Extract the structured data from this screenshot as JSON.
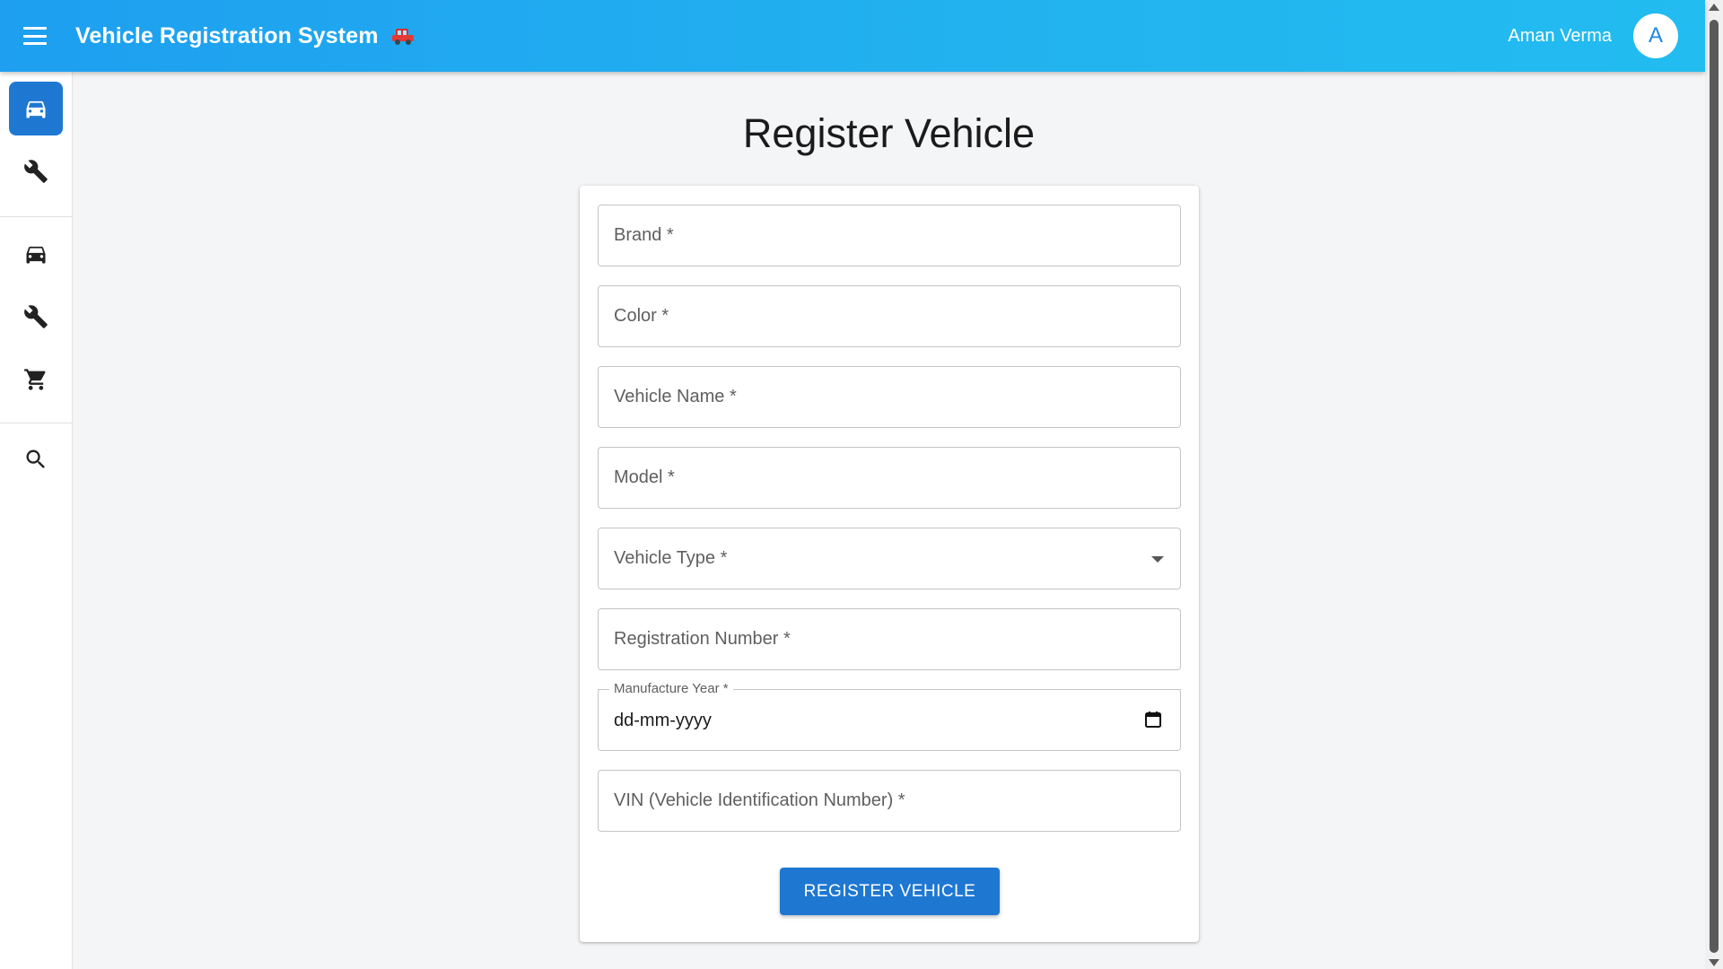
{
  "appbar": {
    "title": "Vehicle Registration System",
    "user_name": "Aman Verma",
    "avatar_initial": "A",
    "menu_icon": "hamburger-menu-icon",
    "title_icon": "red-car-icon"
  },
  "sidebar": {
    "items": [
      {
        "icon": "car-icon",
        "active": true
      },
      {
        "icon": "wrench-icon",
        "active": false
      },
      {
        "icon": "car-icon",
        "active": false
      },
      {
        "icon": "wrench-icon",
        "active": false
      },
      {
        "icon": "shopping-cart-icon",
        "active": false
      },
      {
        "icon": "search-icon",
        "active": false
      }
    ]
  },
  "page": {
    "title": "Register Vehicle"
  },
  "form": {
    "brand_label": "Brand *",
    "color_label": "Color *",
    "vehicle_name_label": "Vehicle Name *",
    "model_label": "Model *",
    "vehicle_type_label": "Vehicle Type *",
    "registration_number_label": "Registration Number *",
    "manufacture_year_label": "Manufacture Year *",
    "manufacture_year_value": "dd-mm-yyyy",
    "vin_label": "VIN (Vehicle Identification Number) *",
    "submit_label": "REGISTER VEHICLE"
  },
  "colors": {
    "appbar": "#1e9ff0",
    "accent": "#1e78d2",
    "background": "#f4f5f7"
  }
}
